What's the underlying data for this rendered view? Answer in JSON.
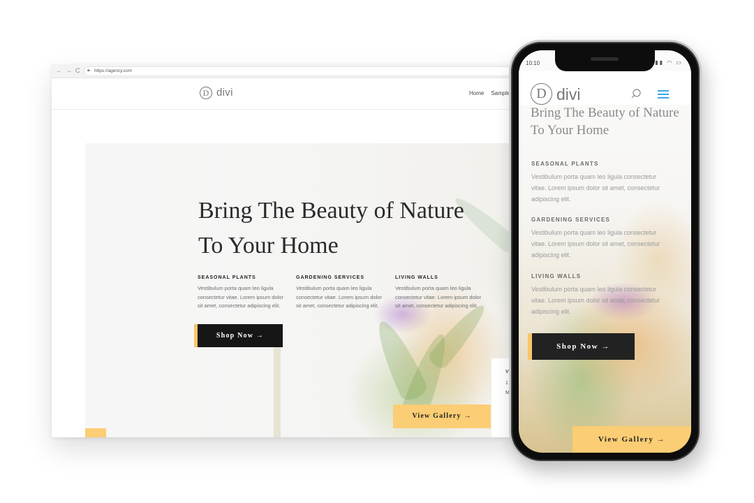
{
  "browser": {
    "url": "https://agency.com",
    "nav_back": "←",
    "nav_forward": "→",
    "nav_reload": "C"
  },
  "site": {
    "logo_letter": "D",
    "logo_text": "divi",
    "menu": [
      "Home",
      "Sample"
    ]
  },
  "hero": {
    "title": "Bring The Beauty of Nature To Your Home",
    "features": [
      {
        "title": "SEASONAL PLANTS",
        "text": "Vestibulum porta quam leo ligula consectetur vitae. Lorem ipsum dolor sit amet, consectetur adipiscing elit."
      },
      {
        "title": "GARDENING SERVICES",
        "text": "Vestibulum porta quam leo ligula consectetur vitae. Lorem ipsum dolor sit amet, consectetur adipiscing elit."
      },
      {
        "title": "LIVING WALLS",
        "text": "Vestibulum porta quam leo ligula consectetur vitae. Lorem ipsum dolor sit amet, consectetur adipiscing elit."
      }
    ],
    "shop_button": "Shop Now →",
    "gallery_button": "View Gallery →",
    "info_card_lines": [
      "V",
      "1",
      "M"
    ]
  },
  "mobile": {
    "status_time": "10:10",
    "status_icons": "▮▮ ◠ ▭",
    "logo_letter": "D",
    "logo_text": "divi",
    "title": "Bring The Beauty of Nature To Your Home",
    "features": [
      {
        "title": "SEASONAL PLANTS",
        "text": "Vestibulum porta quam leo ligula consectetur vitae. Lorem ipsum dolor sit amet, consectetur adipiscing elit."
      },
      {
        "title": "GARDENING SERVICES",
        "text": "Vestibulum porta quam leo ligula consectetur vitae. Lorem ipsum dolor sit amet, consectetur adipiscing elit."
      },
      {
        "title": "LIVING WALLS",
        "text": "Vestibulum porta quam leo ligula consectetur vitae. Lorem ipsum dolor sit amet, consectetur adipiscing elit."
      }
    ],
    "shop_button": "Shop Now →",
    "gallery_button": "View Gallery →"
  },
  "colors": {
    "accent": "#fbcd74",
    "dark_button": "#161616",
    "menu_icon": "#3aa7e6"
  }
}
